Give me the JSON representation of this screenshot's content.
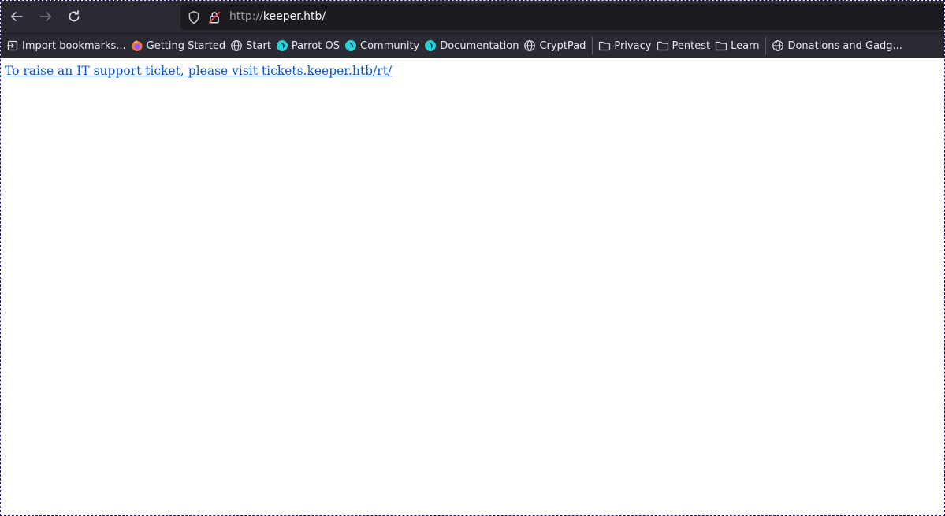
{
  "browser": {
    "url_scheme": "http://",
    "url_host": "keeper.htb/"
  },
  "bookmarks": [
    {
      "label": "Import bookmarks...",
      "icon": "import-icon"
    },
    {
      "label": "Getting Started",
      "icon": "firefox-icon"
    },
    {
      "label": "Start",
      "icon": "globe-icon"
    },
    {
      "label": "Parrot OS",
      "icon": "parrot-icon"
    },
    {
      "label": "Community",
      "icon": "parrot-icon"
    },
    {
      "label": "Documentation",
      "icon": "parrot-icon"
    },
    {
      "label": "CryptPad",
      "icon": "globe-icon"
    },
    {
      "label": "Privacy",
      "icon": "folder-icon"
    },
    {
      "label": "Pentest",
      "icon": "folder-icon"
    },
    {
      "label": "Learn",
      "icon": "folder-icon"
    },
    {
      "label": "Donations and Gadg...",
      "icon": "globe-icon"
    }
  ],
  "page": {
    "link_text": "To raise an IT support ticket, please visit tickets.keeper.htb/rt/"
  },
  "colors": {
    "toolbar": "#2b2a33",
    "urlbar": "#1c1b22",
    "link": "#0a58ca",
    "parrot": "#27d1d8"
  }
}
